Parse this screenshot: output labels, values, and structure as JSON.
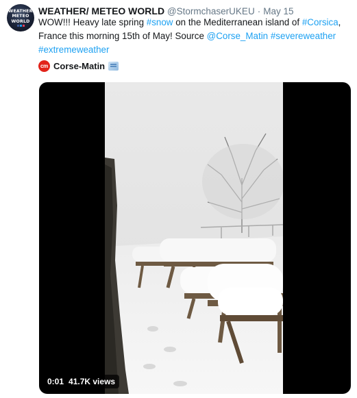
{
  "tweet": {
    "author": {
      "name": "WEATHER/ METEO WORLD",
      "handle": "@StormchaserUKEU",
      "avatar_lines": [
        "WEATHER",
        "METEO",
        "WORLD"
      ]
    },
    "separator": "·",
    "timestamp": "May 15",
    "text_parts": {
      "p1": "WOW!!! Heavy late spring ",
      "tag_snow": "#snow",
      "p2": " on the Mediterranean island of ",
      "tag_corsica": "#Corsica",
      "p3": ", France this morning 15th of May! Source ",
      "mention": "@Corse_Matin",
      "p4": " ",
      "tag_severe": "#severeweather",
      "p5": " ",
      "tag_extreme": "#extremeweather"
    },
    "source": {
      "logo_text": "cm",
      "name": "Corse-Matin",
      "badge_icon": "verified-media-badge-icon"
    },
    "video": {
      "elapsed": "0:01",
      "views": "41.7K views"
    }
  },
  "colors": {
    "link": "#1da1f2",
    "secondary_text": "#657786",
    "logo_red": "#e2231a"
  }
}
